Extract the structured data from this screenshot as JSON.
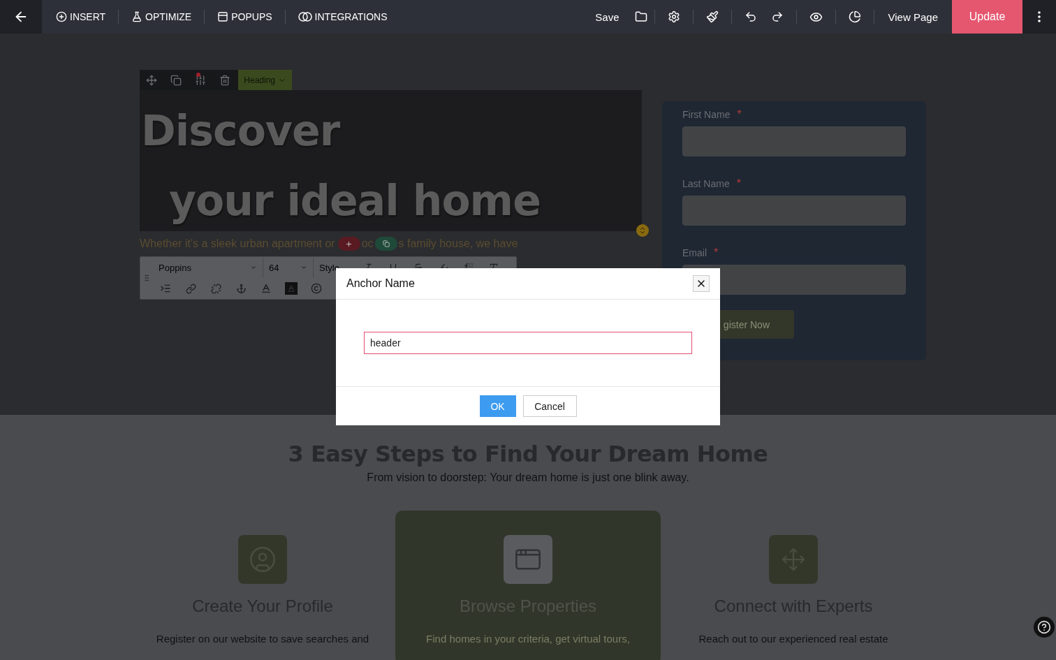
{
  "topbar": {
    "nav": [
      {
        "kind": "insert",
        "label": "INSERT"
      },
      {
        "kind": "optimize",
        "label": "OPTIMIZE"
      },
      {
        "kind": "popups",
        "label": "POPUPS"
      },
      {
        "kind": "integrations",
        "label": "INTEGRATIONS"
      }
    ],
    "save": "Save",
    "view_page": "View Page",
    "update": "Update"
  },
  "element_toolbar": {
    "tag": "Heading",
    "has_notice": true
  },
  "hero": {
    "heading_lines": [
      "Discover",
      "your ideal home"
    ],
    "subtitle_parts": [
      "Whether it's a sleek urban apartment or",
      "oc",
      "s family house, we have"
    ]
  },
  "text_toolbar": {
    "font": "Poppins",
    "size": "64",
    "style": "Style"
  },
  "form": {
    "fields": [
      {
        "label": "First Name",
        "required_mark": "*"
      },
      {
        "label": "Last Name",
        "required_mark": "*"
      },
      {
        "label": "Email",
        "required_mark": "*"
      }
    ],
    "button": "gister Now"
  },
  "steps": {
    "title": "3 Easy Steps to Find Your Dream Home",
    "subtitle": "From vision to doorstep: Your dream home is just one blink away.",
    "items": [
      {
        "kind": "profile",
        "title": "Create Your Profile",
        "text": "Register on our website to save searches and",
        "highlighted": false
      },
      {
        "kind": "browser",
        "title": "Browse Properties",
        "text": "Find homes in your criteria, get virtual tours,",
        "highlighted": true
      },
      {
        "kind": "connect",
        "title": "Connect with Experts",
        "text": "Reach out to our experienced real estate",
        "highlighted": false
      }
    ]
  },
  "dialog": {
    "title": "Anchor Name",
    "value": "header",
    "ok": "OK",
    "cancel": "Cancel"
  }
}
